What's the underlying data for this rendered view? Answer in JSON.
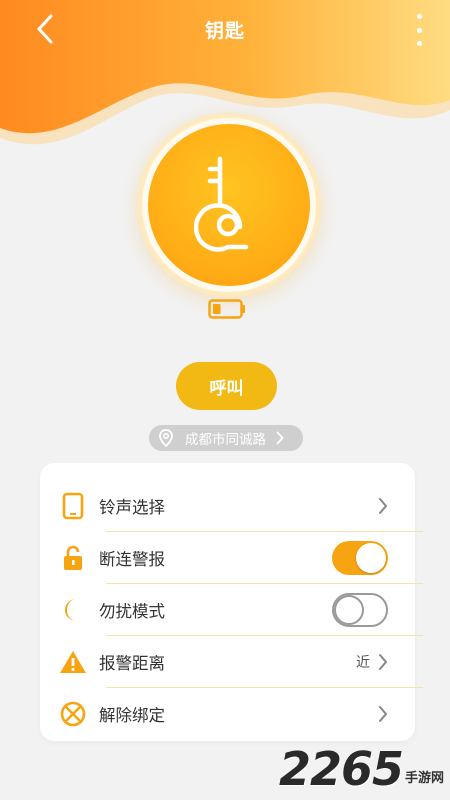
{
  "header": {
    "title": "钥匙",
    "colors": {
      "start": "#ff8a1f",
      "end": "#ffd97a"
    }
  },
  "device": {
    "icon": "key-icon",
    "battery_level": 0.3
  },
  "actions": {
    "call_label": "呼叫"
  },
  "location": {
    "text": "成都市同诚路"
  },
  "settings": {
    "items": [
      {
        "icon": "phone-icon",
        "label": "铃声选择",
        "control": "chevron"
      },
      {
        "icon": "lock-icon",
        "label": "断连警报",
        "control": "toggle",
        "on": true
      },
      {
        "icon": "moon-icon",
        "label": "勿扰模式",
        "control": "toggle",
        "on": false
      },
      {
        "icon": "warning-icon",
        "label": "报警距离",
        "value": "近",
        "control": "chevron"
      },
      {
        "icon": "unbind-icon",
        "label": "解除绑定",
        "control": "chevron"
      }
    ]
  },
  "watermark": {
    "number": "2265",
    "text": "手游网"
  },
  "accent": "#f7a411"
}
